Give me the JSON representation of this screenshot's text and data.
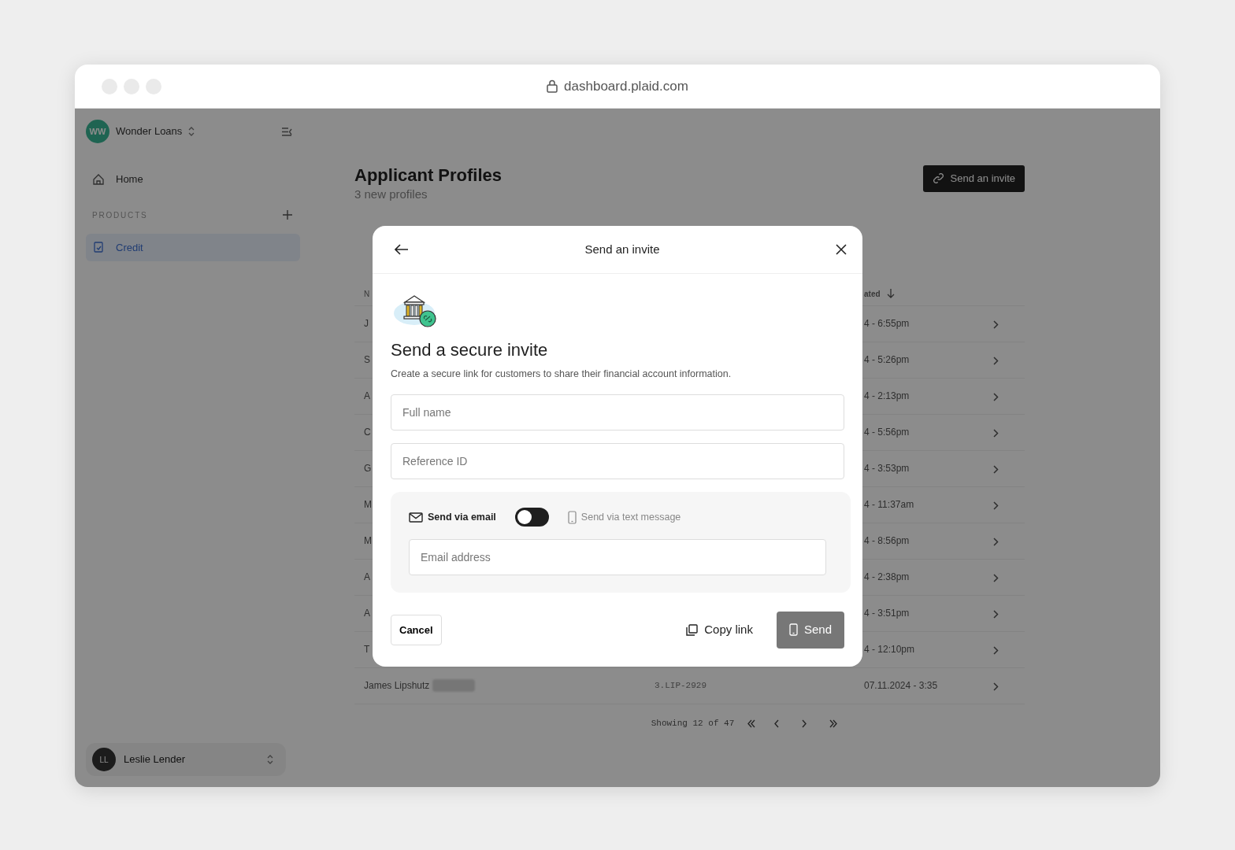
{
  "browser": {
    "url": "dashboard.plaid.com"
  },
  "sidebar": {
    "org": {
      "initials": "WW",
      "name": "Wonder Loans"
    },
    "items": [
      {
        "label": "Home",
        "kind": "home",
        "selected": false
      }
    ],
    "section": {
      "title": "PRODUCTS",
      "items": [
        {
          "label": "Credit",
          "kind": "credit",
          "selected": true
        }
      ]
    },
    "user": {
      "initials": "LL",
      "name": "Leslie Lender"
    }
  },
  "page": {
    "title": "Applicant Profiles",
    "subtitle": "3 new profiles",
    "action": "Send an invite"
  },
  "table": {
    "columns": [
      {
        "label": "N"
      },
      {
        "label": "ated",
        "sorted": true
      }
    ],
    "rows": [
      {
        "column_1": "J",
        "date": "4 - 6:55pm"
      },
      {
        "column_1": "S",
        "date": "4 - 5:26pm"
      },
      {
        "column_1": "A",
        "date": "4 - 2:13pm"
      },
      {
        "column_1": "C",
        "date": "4 - 5:56pm"
      },
      {
        "column_1": "G",
        "date": "4 - 3:53pm"
      },
      {
        "column_1": "M",
        "date": "4 - 11:37am"
      },
      {
        "column_1": "M",
        "date": "4 - 8:56pm"
      },
      {
        "column_1": "A",
        "date": "4 - 2:38pm"
      },
      {
        "column_1": "A",
        "date": "4 - 3:51pm"
      },
      {
        "column_1": "T",
        "date": "4 - 12:10pm"
      },
      {
        "column_1": "James Lipshutz",
        "badge": true,
        "reference": "3.LIP-2929",
        "date": "07.11.2024 - 3:35"
      }
    ],
    "pagination": "Showing 12 of 47"
  },
  "modal": {
    "title": "Send an invite",
    "heading": "Send a secure invite",
    "description": "Create a secure link for customers to share their financial account information.",
    "fields": [
      {
        "placeholder": "Full name"
      },
      {
        "placeholder": "Reference ID"
      }
    ],
    "delivery": {
      "toggle_on": false,
      "options": [
        {
          "label": "Send via email",
          "kind": "email",
          "selected": true
        },
        {
          "label": "Send via text message",
          "kind": "text",
          "selected": false
        }
      ],
      "placeholder": "Email address"
    },
    "buttons": {
      "cancel": "Cancel",
      "copy": "Copy link",
      "send": {
        "label": "Send",
        "disabled": true
      }
    }
  }
}
